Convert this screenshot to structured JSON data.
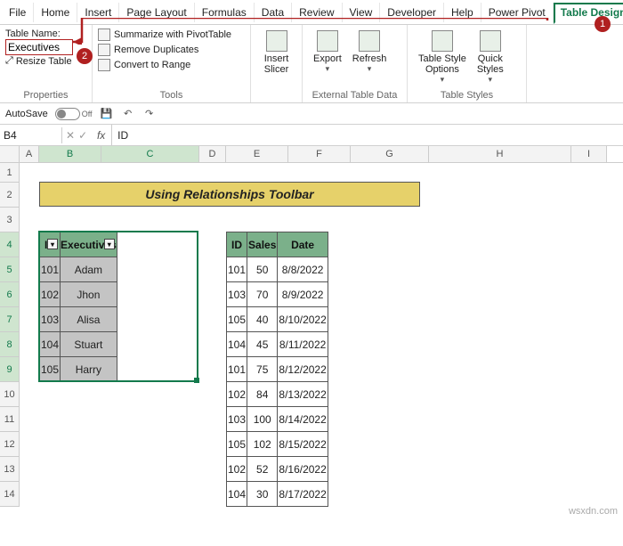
{
  "menu": {
    "items": [
      "File",
      "Home",
      "Insert",
      "Page Layout",
      "Formulas",
      "Data",
      "Review",
      "View",
      "Developer",
      "Help",
      "Power Pivot",
      "Table Design"
    ],
    "active_index": 11
  },
  "callouts": {
    "c1": "1",
    "c2": "2"
  },
  "ribbon": {
    "properties": {
      "label": "Table Name:",
      "value": "Executives",
      "resize": "Resize Table",
      "group": "Properties"
    },
    "tools": {
      "pivot": "Summarize with PivotTable",
      "dups": "Remove Duplicates",
      "range": "Convert to Range",
      "group": "Tools"
    },
    "slicer": "Insert\nSlicer",
    "export": "Export",
    "refresh": "Refresh",
    "extgroup": "External Table Data",
    "styleopts": "Table Style\nOptions",
    "quickstyles": "Quick\nStyles",
    "stylesgroup": "Table Styles"
  },
  "qat": {
    "autosave": "AutoSave",
    "state": "Off"
  },
  "namebox": "B4",
  "fx": "fx",
  "fvalue": "ID",
  "cols": [
    "A",
    "B",
    "C",
    "D",
    "E",
    "F",
    "G",
    "H",
    "I"
  ],
  "rows": [
    "1",
    "2",
    "3",
    "4",
    "5",
    "6",
    "7",
    "8",
    "9",
    "10",
    "11",
    "12",
    "13",
    "14"
  ],
  "title": "Using Relationships Toolbar",
  "table1": {
    "headers": [
      "ID",
      "Executives"
    ],
    "rows": [
      [
        "101",
        "Adam"
      ],
      [
        "102",
        "Jhon"
      ],
      [
        "103",
        "Alisa"
      ],
      [
        "104",
        "Stuart"
      ],
      [
        "105",
        "Harry"
      ]
    ]
  },
  "table2": {
    "headers": [
      "ID",
      "Sales",
      "Date"
    ],
    "rows": [
      [
        "101",
        "50",
        "8/8/2022"
      ],
      [
        "103",
        "70",
        "8/9/2022"
      ],
      [
        "105",
        "40",
        "8/10/2022"
      ],
      [
        "104",
        "45",
        "8/11/2022"
      ],
      [
        "101",
        "75",
        "8/12/2022"
      ],
      [
        "102",
        "84",
        "8/13/2022"
      ],
      [
        "103",
        "100",
        "8/14/2022"
      ],
      [
        "105",
        "102",
        "8/15/2022"
      ],
      [
        "102",
        "52",
        "8/16/2022"
      ],
      [
        "104",
        "30",
        "8/17/2022"
      ]
    ]
  },
  "watermark": "wsxdn.com"
}
